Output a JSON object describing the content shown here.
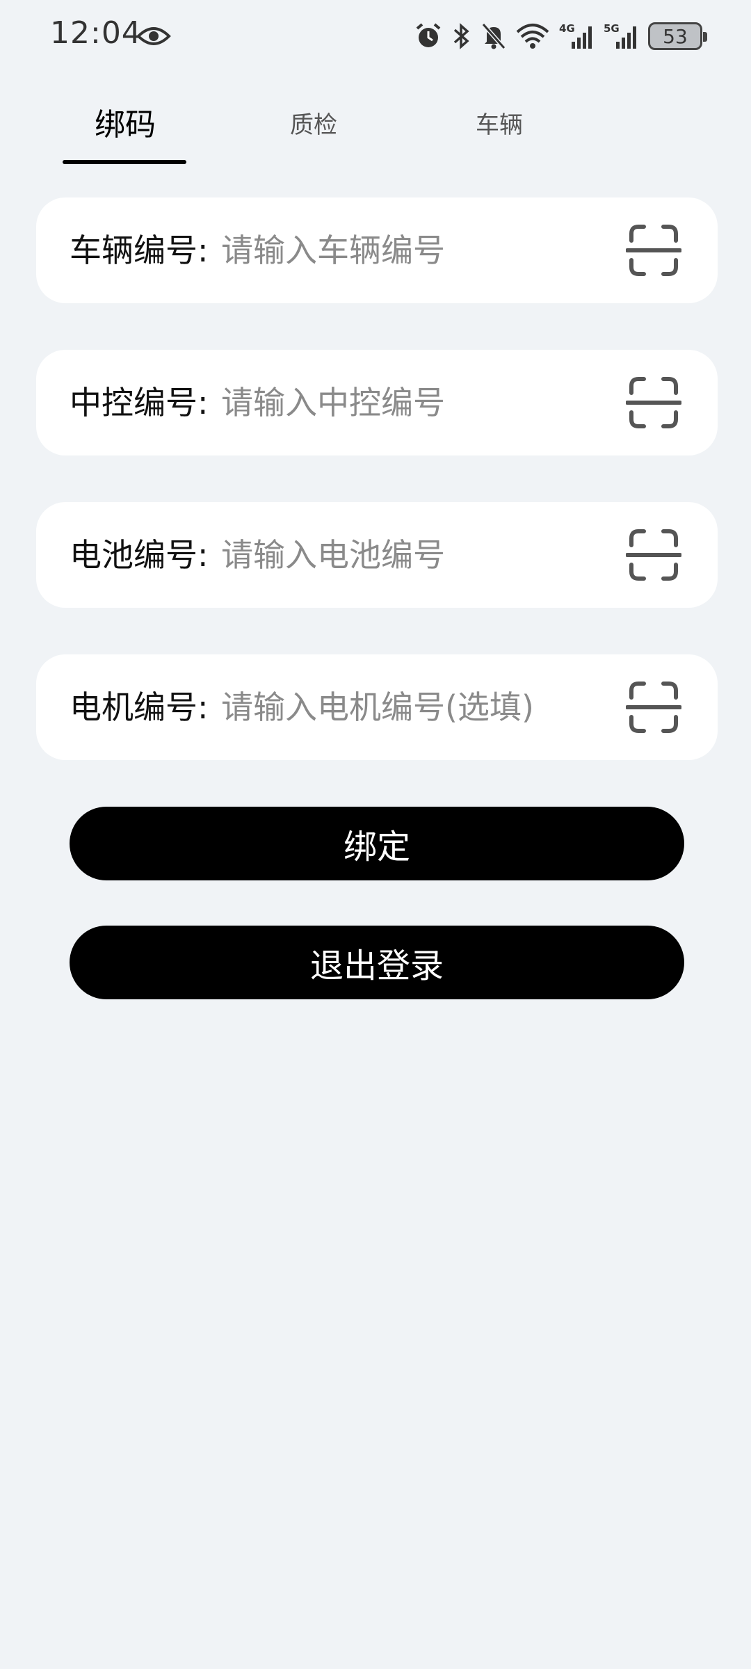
{
  "status_bar": {
    "time": "12:04",
    "battery": "53",
    "icons": [
      "eye-icon",
      "alarm-icon",
      "bluetooth-icon",
      "mute-icon",
      "wifi-icon",
      "signal-4g-icon",
      "signal-5g-icon",
      "battery-icon"
    ],
    "net1": "4G",
    "net2": "5G"
  },
  "tabs": [
    {
      "label": "绑码",
      "active": true
    },
    {
      "label": "质检",
      "active": false
    },
    {
      "label": "车辆",
      "active": false
    }
  ],
  "fields": [
    {
      "label": "车辆编号:",
      "placeholder": "请输入车辆编号",
      "value": ""
    },
    {
      "label": "中控编号:",
      "placeholder": "请输入中控编号",
      "value": ""
    },
    {
      "label": "电池编号:",
      "placeholder": "请输入电池编号",
      "value": ""
    },
    {
      "label": "电机编号:",
      "placeholder": "请输入电机编号(选填)",
      "value": ""
    }
  ],
  "buttons": {
    "bind": "绑定",
    "logout": "退出登录"
  },
  "colors": {
    "background": "#f0f3f6",
    "card": "#ffffff",
    "button": "#000000",
    "placeholder": "#8a8a8a"
  }
}
